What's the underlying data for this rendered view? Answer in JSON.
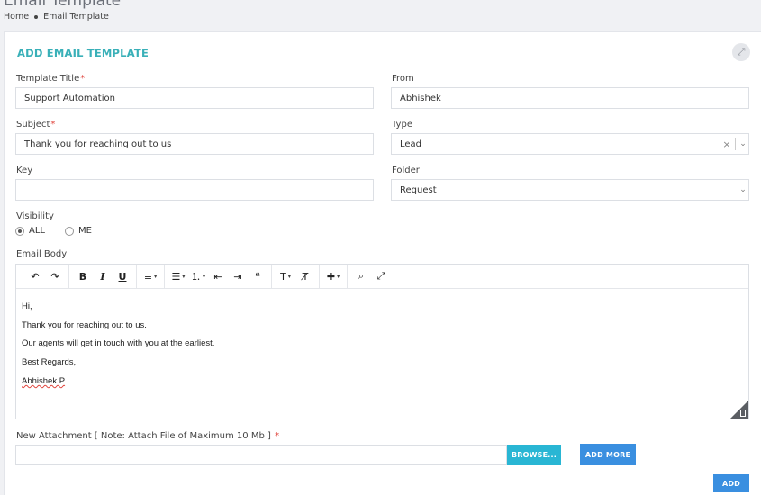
{
  "header": {
    "page_title": "Email Template",
    "breadcrumb": [
      "Home",
      "Email Template"
    ]
  },
  "card": {
    "title": "ADD EMAIL TEMPLATE",
    "expand_icon": "expand-arrows-icon"
  },
  "form": {
    "template_title": {
      "label": "Template Title",
      "required": "*",
      "value": "Support Automation"
    },
    "from": {
      "label": "From",
      "value": "Abhishek"
    },
    "subject": {
      "label": "Subject",
      "required": "*",
      "value": "Thank you for reaching out to us"
    },
    "type": {
      "label": "Type",
      "value": "Lead",
      "clear": "×",
      "chevron": "⌄"
    },
    "key": {
      "label": "Key",
      "value": ""
    },
    "folder": {
      "label": "Folder",
      "value": "Request",
      "chevron": "⌄"
    },
    "visibility": {
      "label": "Visibility",
      "options": [
        "ALL",
        "ME"
      ],
      "selected": "ALL"
    },
    "email_body": {
      "label": "Email Body",
      "toolbar": {
        "undo": "↶",
        "redo": "↷",
        "bold": "B",
        "italic": "I",
        "underline": "U",
        "align": "≡",
        "bullets": "☰",
        "numbers": "⒈",
        "outdent": "⇤",
        "indent": "⇥",
        "quote": "❝",
        "text_style": "T",
        "clear_format": "T̸",
        "insert": "✚",
        "find": "⌕",
        "fullscreen": "⤢",
        "caret": "▾"
      },
      "lines": [
        "Hi,",
        "Thank you for reaching out to us.",
        "Our agents will get in touch with you at the earliest.",
        "Best Regards,",
        "Abhishek P"
      ]
    },
    "attachment": {
      "label": "New Attachment [ Note: Attach File of Maximum 10 Mb ]",
      "required": "*",
      "value": ""
    }
  },
  "buttons": {
    "browse": "BROWSE...",
    "add_more": "ADD MORE",
    "add": "ADD"
  },
  "colors": {
    "accent_teal": "#39b0b8",
    "browse": "#29b6d4",
    "primary": "#3a8fe0",
    "required": "#e0433b"
  }
}
